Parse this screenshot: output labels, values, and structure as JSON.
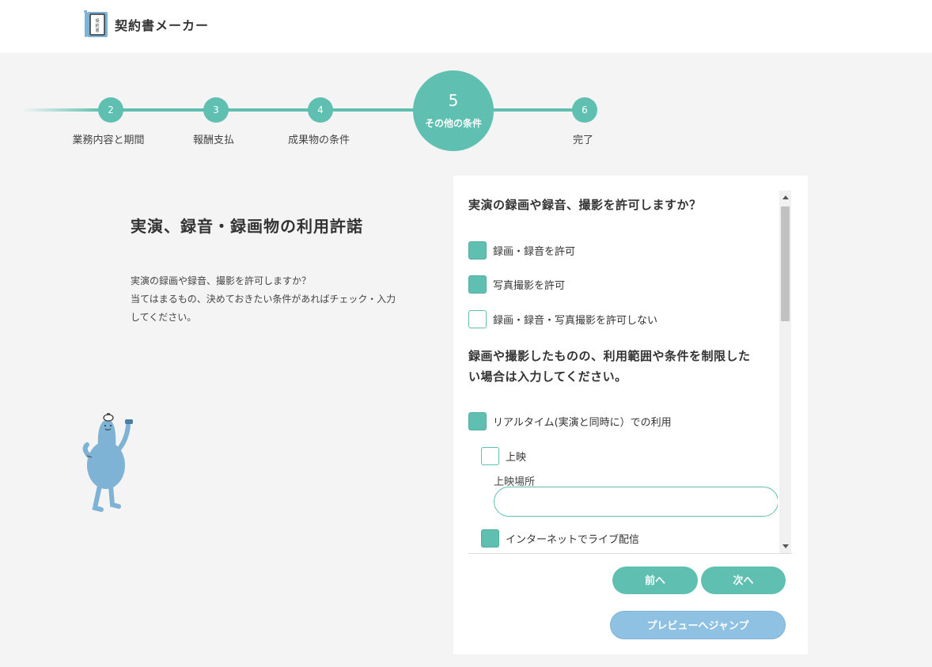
{
  "app": {
    "name": "契約書メーカー",
    "logo_text": "契約書"
  },
  "stepper": {
    "steps": [
      {
        "number": "2",
        "label": "業務内容と期間"
      },
      {
        "number": "3",
        "label": "報酬支払"
      },
      {
        "number": "4",
        "label": "成果物の条件"
      },
      {
        "number": "5",
        "label": "その他の条件",
        "current": true
      },
      {
        "number": "6",
        "label": "完了"
      }
    ]
  },
  "intro": {
    "title": "実演、録音・録画物の利用許諾",
    "description_line1": "実演の録画や録音、撮影を許可しますか？",
    "description_line2": "当てはまるもの、決めておきたい条件があればチェック・入力",
    "description_line3": "してください。"
  },
  "form": {
    "question1": "実演の録画や録音、撮影を許可しますか？",
    "options1": [
      {
        "label": "録画・録音を許可",
        "checked": true
      },
      {
        "label": "写真撮影を許可",
        "checked": true
      },
      {
        "label": "録画・録音・写真撮影を許可しない",
        "checked": false
      }
    ],
    "question2_line1": "録画や撮影したものの、利用範囲や条件を制限した",
    "question2_line2": "い場合は入力してください。",
    "realtime": {
      "label": "リアルタイム(実演と同時に）での利用",
      "checked": true
    },
    "screening": {
      "label": "上映",
      "checked": false
    },
    "screening_place": {
      "label": "上映場所",
      "value": "",
      "placeholder": ""
    },
    "livestream": {
      "label": "インターネットでライブ配信",
      "checked": true
    }
  },
  "buttons": {
    "prev": "前へ",
    "next": "次へ",
    "preview": "プレビューへジャンプ"
  },
  "colors": {
    "accent": "#5fbfb0",
    "preview_button": "#8fc1e3",
    "background": "#f4f4f4"
  }
}
